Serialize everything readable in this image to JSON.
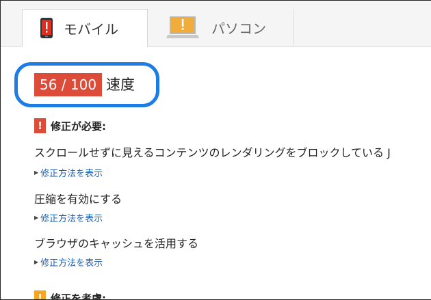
{
  "tabs": [
    {
      "label": "モバイル",
      "icon": "mobile-warning-icon",
      "active": true
    },
    {
      "label": "パソコン",
      "icon": "desktop-warning-icon",
      "active": false
    }
  ],
  "score": {
    "value": "56 / 100",
    "label": "速度"
  },
  "must_fix": {
    "title": "修正が必要:",
    "rules": [
      {
        "title": "スクロールせずに見えるコンテンツのレンダリングをブロックしている J",
        "link": "修正方法を表示"
      },
      {
        "title": "圧縮を有効にする",
        "link": "修正方法を表示"
      },
      {
        "title": "ブラウザのキャッシュを活用する",
        "link": "修正方法を表示"
      }
    ]
  },
  "consider_fix": {
    "title": "修正を考慮:"
  },
  "colors": {
    "accent_ring": "#1e7de5",
    "score_badge": "#dd4b39",
    "warning_orange": "#f5a623",
    "link": "#1a5fb4"
  }
}
